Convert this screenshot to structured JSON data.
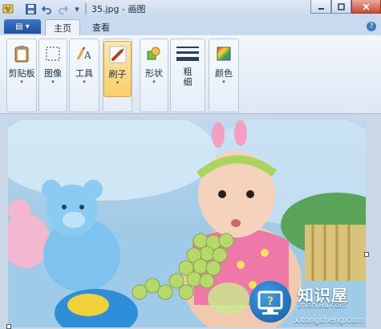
{
  "title": {
    "text": "35.jpg - 画图"
  },
  "quick_access": {
    "menu_arrow": "▾"
  },
  "tabs": {
    "file_menu_label": "▤ ▾",
    "items": [
      {
        "label": "主页"
      },
      {
        "label": "查看"
      }
    ],
    "help": "?"
  },
  "ribbon": {
    "groups": [
      {
        "label": "剪贴板",
        "icon": "clipboard-icon"
      },
      {
        "label": "图像",
        "icon": "image-select-icon"
      },
      {
        "label": "工具",
        "icon": "tools-icon"
      },
      {
        "label": "刷子",
        "icon": "brush-icon"
      },
      {
        "label": "形状",
        "icon": "shapes-icon"
      },
      {
        "label": "粗\n细",
        "icon": "line-size-icon"
      },
      {
        "label": "颜色",
        "icon": "colors-icon"
      }
    ],
    "arrow": "▾"
  },
  "watermark": {
    "title": "知识屋",
    "subtitle": "zhishiwu.com",
    "url": "xitongcheng.com"
  },
  "colors": {
    "selected_group": "#f9cf6a",
    "brand_blue": "#1f4f9b"
  }
}
